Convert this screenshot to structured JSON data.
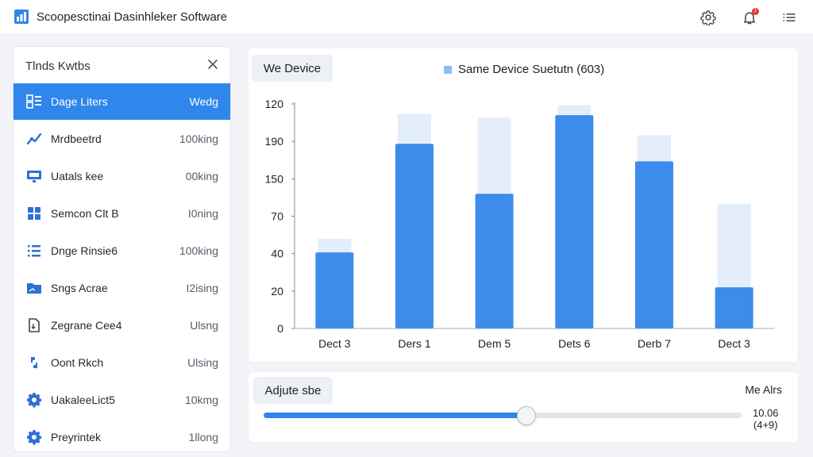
{
  "app": {
    "title": "Scoopesctinai Dasinhleker Software",
    "notification_count": "1",
    "colors": {
      "accent": "#2f86ec",
      "bar": "#3d8cec",
      "bar_ghost": "#e4eefa",
      "badge": "#e53935"
    }
  },
  "header_icons": [
    "app-logo-icon",
    "gear-icon",
    "bell-icon",
    "menu-icon"
  ],
  "panel": {
    "title": "Tlnds Kwtbs",
    "items": [
      {
        "label": "Dage Liters",
        "value": "Wedg",
        "icon": "grid-list-icon",
        "active": true
      },
      {
        "label": "Mrdbeetrd",
        "value": "100king",
        "icon": "trend-icon",
        "active": false
      },
      {
        "label": "Uatals kee",
        "value": "00king",
        "icon": "monitor-icon",
        "active": false
      },
      {
        "label": "Semcon Clt B",
        "value": "I0ning",
        "icon": "grid-icon",
        "active": false
      },
      {
        "label": "Dnge Rinsie6",
        "value": "100king",
        "icon": "list-icon",
        "active": false
      },
      {
        "label": "Sngs Acrae",
        "value": "I2ising",
        "icon": "folder-icon",
        "active": false
      },
      {
        "label": "Zegrane Cee4",
        "value": "Ulsng",
        "icon": "document-icon",
        "active": false
      },
      {
        "label": "Oont Rkch",
        "value": "Ulsing",
        "icon": "link-icon",
        "active": false
      },
      {
        "label": "UakaleeLict5",
        "value": "10kmg",
        "icon": "gear-icon",
        "active": false
      },
      {
        "label": "Preyrintek",
        "value": "1llong",
        "icon": "gear-icon",
        "active": false
      }
    ]
  },
  "chart_tab": {
    "label": "We Device"
  },
  "chart_data": {
    "type": "bar",
    "title": "",
    "legend": "Same Device Suetutn (603)",
    "legend_position": "top-center",
    "xlabel": "",
    "ylabel": "",
    "categories": [
      "Dect 3",
      "Ders 1",
      "Dem 5",
      "Dets 6",
      "Derb 7",
      "Dect 3"
    ],
    "y_tick_labels": [
      "0",
      "20",
      "40",
      "70",
      "150",
      "190",
      "120"
    ],
    "series": [
      {
        "name": "Same Device Suetutn (603)",
        "values": [
          61,
          148,
          108,
          171,
          134,
          33
        ]
      },
      {
        "values": [
          72,
          172,
          169,
          179,
          155,
          100
        ]
      }
    ],
    "ylim": [
      0,
      180
    ],
    "grid": false
  },
  "slider": {
    "label": "Adjute sbe",
    "right_label": "Me Alrs",
    "value_line1": "10.06",
    "value_line2": "(4+9)",
    "fraction": 0.55
  }
}
